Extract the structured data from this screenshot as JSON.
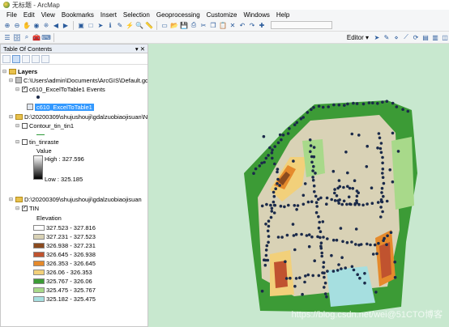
{
  "window": {
    "title": "无标题 - ArcMap"
  },
  "menu": [
    "File",
    "Edit",
    "View",
    "Bookmarks",
    "Insert",
    "Selection",
    "Geoprocessing",
    "Customize",
    "Windows",
    "Help"
  ],
  "toolbar": {
    "editor_label": "Editor ▾"
  },
  "toc": {
    "title": "Table Of Contents",
    "layers_root": "Layers",
    "items": [
      {
        "label": "C:\\Users\\admin\\Documents\\ArcGIS\\Default.gd"
      },
      {
        "label": "c610_ExcelToTable1 Events"
      },
      {
        "label": "c610_ExcelToTable1"
      },
      {
        "label": "D:\\20200309\\shujushouji\\gdalzuobiaojisuan\\N"
      },
      {
        "label": "Contour_tin_tin1"
      },
      {
        "label": "tin_tinraste"
      },
      {
        "label": "D:\\20200309\\shujushouji\\gdalzuobiaojisuan"
      },
      {
        "label": "TIN"
      }
    ],
    "raster_legend": {
      "title": "Value",
      "high": "High : 327.596",
      "low": "Low : 325.185"
    },
    "tin_legend": {
      "title": "Elevation",
      "classes": [
        {
          "label": "327.523 - 327.816",
          "color": "#ffffff"
        },
        {
          "label": "327.231 - 327.523",
          "color": "#d9d2b6"
        },
        {
          "label": "326.938 - 327.231",
          "color": "#8b4a1e"
        },
        {
          "label": "326.645 - 326.938",
          "color": "#c0532f"
        },
        {
          "label": "326.353 - 326.645",
          "color": "#e58a2c"
        },
        {
          "label": "326.06 - 326.353",
          "color": "#f2d07a"
        },
        {
          "label": "325.767 - 326.06",
          "color": "#3c9b36"
        },
        {
          "label": "325.475 - 325.767",
          "color": "#a8d98a"
        },
        {
          "label": "325.182 - 325.475",
          "color": "#a6dfe0"
        }
      ]
    }
  },
  "map": {
    "background": "#c8e8cf",
    "watermark": "https://blog.csdn.net/wei@51CTO博客"
  }
}
